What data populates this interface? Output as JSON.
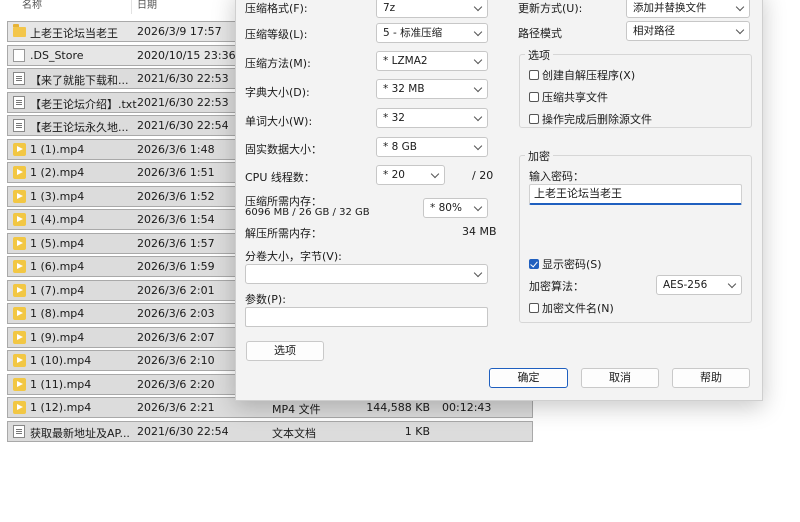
{
  "explorer": {
    "headers": {
      "name": "名称",
      "date": "日期"
    },
    "rows": [
      {
        "icon": "folder-icon",
        "name": "上老王论坛当老王",
        "date": "2026/3/9 17:57",
        "type": "",
        "size": "",
        "duration": ""
      },
      {
        "icon": "file-icon",
        "name": ".DS_Store",
        "date": "2020/10/15 23:36",
        "type": "",
        "size": "",
        "duration": ""
      },
      {
        "icon": "text-file-icon",
        "name": "【来了就能下载和...",
        "date": "2021/6/30 22:53",
        "type": "",
        "size": "",
        "duration": ""
      },
      {
        "icon": "text-file-icon",
        "name": "【老王论坛介绍】.txt",
        "date": "2021/6/30 22:53",
        "type": "",
        "size": "",
        "duration": ""
      },
      {
        "icon": "text-file-icon",
        "name": "【老王论坛永久地...",
        "date": "2021/6/30 22:54",
        "type": "",
        "size": "",
        "duration": ""
      },
      {
        "icon": "media-file-icon",
        "name": "1 (1).mp4",
        "date": "2026/3/6 1:48",
        "type": "",
        "size": "",
        "duration": ""
      },
      {
        "icon": "media-file-icon",
        "name": "1 (2).mp4",
        "date": "2026/3/6 1:51",
        "type": "",
        "size": "",
        "duration": ""
      },
      {
        "icon": "media-file-icon",
        "name": "1 (3).mp4",
        "date": "2026/3/6 1:52",
        "type": "",
        "size": "",
        "duration": ""
      },
      {
        "icon": "media-file-icon",
        "name": "1 (4).mp4",
        "date": "2026/3/6 1:54",
        "type": "",
        "size": "",
        "duration": ""
      },
      {
        "icon": "media-file-icon",
        "name": "1 (5).mp4",
        "date": "2026/3/6 1:57",
        "type": "",
        "size": "",
        "duration": ""
      },
      {
        "icon": "media-file-icon",
        "name": "1 (6).mp4",
        "date": "2026/3/6 1:59",
        "type": "",
        "size": "",
        "duration": ""
      },
      {
        "icon": "media-file-icon",
        "name": "1 (7).mp4",
        "date": "2026/3/6 2:01",
        "type": "",
        "size": "",
        "duration": ""
      },
      {
        "icon": "media-file-icon",
        "name": "1 (8).mp4",
        "date": "2026/3/6 2:03",
        "type": "",
        "size": "",
        "duration": ""
      },
      {
        "icon": "media-file-icon",
        "name": "1 (9).mp4",
        "date": "2026/3/6 2:07",
        "type": "",
        "size": "",
        "duration": ""
      },
      {
        "icon": "media-file-icon",
        "name": "1 (10).mp4",
        "date": "2026/3/6 2:10",
        "type": "",
        "size": "",
        "duration": ""
      },
      {
        "icon": "media-file-icon",
        "name": "1 (11).mp4",
        "date": "2026/3/6 2:20",
        "type": "",
        "size": "",
        "duration": ""
      },
      {
        "icon": "media-file-icon",
        "name": "1 (12).mp4",
        "date": "2026/3/6 2:21",
        "type": "MP4 文件",
        "size": "144,588 KB",
        "duration": "00:12:43"
      },
      {
        "icon": "text-file-icon",
        "name": "获取最新地址及AP...",
        "date": "2021/6/30 22:54",
        "type": "文本文档",
        "size": "1 KB",
        "duration": ""
      }
    ]
  },
  "dialog": {
    "format_label": "压缩格式(F):",
    "format_value": "7z",
    "level_label": "压缩等级(L):",
    "level_value": "5 - 标准压缩",
    "method_label": "压缩方法(M):",
    "method_value": "* LZMA2",
    "dict_label": "字典大小(D):",
    "dict_value": "* 32 MB",
    "word_label": "单词大小(W):",
    "word_value": "* 32",
    "solid_label": "固实数据大小：",
    "solid_value": "* 8 GB",
    "cpu_label": "CPU 线程数：",
    "cpu_value": "* 20",
    "cpu_total": "/ 20",
    "mem_compress_label": "压缩所需内存：",
    "mem_compress_detail": "6096 MB / 26 GB / 32 GB",
    "mem_percent_value": "* 80%",
    "mem_decompress_label": "解压所需内存：",
    "mem_decompress_value": "34 MB",
    "split_label": "分卷大小，字节(V):",
    "split_value": "",
    "params_label": "参数(P):",
    "params_value": "",
    "options_button": "选项",
    "update_label": "更新方式(U):",
    "update_value": "添加并替换文件",
    "path_label": "路径模式",
    "path_value": "相对路径",
    "options_group": "选项",
    "sfx_label": "创建自解压程序(X)",
    "sfx_checked": false,
    "shared_label": "压缩共享文件",
    "shared_checked": false,
    "delete_label": "操作完成后删除源文件",
    "delete_checked": false,
    "encrypt_group": "加密",
    "password_label": "输入密码：",
    "password_value": "上老王论坛当老王",
    "show_password_label": "显示密码(S)",
    "show_password_checked": true,
    "enc_method_label": "加密算法：",
    "enc_method_value": "AES-256",
    "enc_names_label": "加密文件名(N)",
    "enc_names_checked": false,
    "ok_button": "确定",
    "cancel_button": "取消",
    "help_button": "帮助"
  }
}
